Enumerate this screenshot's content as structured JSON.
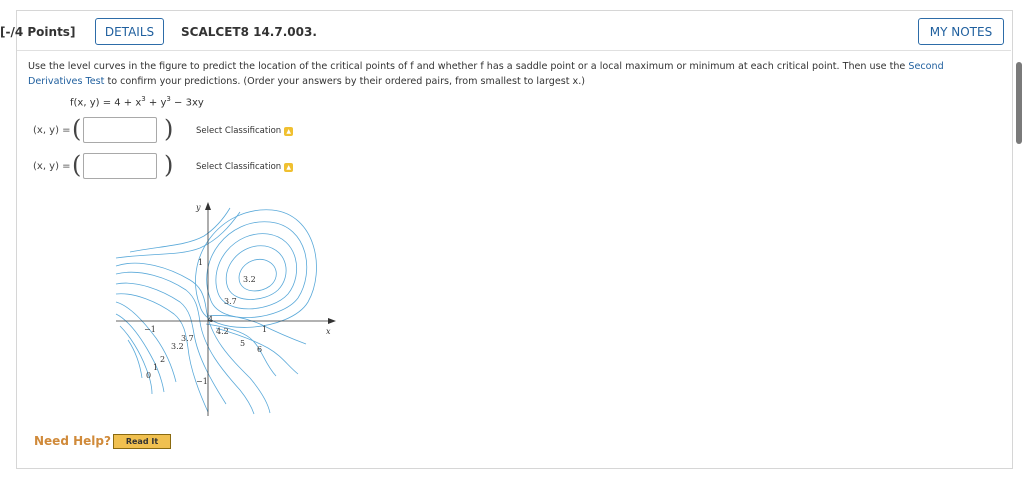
{
  "header": {
    "points": "[-/4 Points]",
    "details_label": "DETAILS",
    "problem_code": "SCALCET8 14.7.003.",
    "my_notes_label": "MY NOTES"
  },
  "question": {
    "text_before_link": "Use the level curves in the figure to predict the location of the critical points of f and whether f has a saddle point or a local maximum or minimum at each critical point. Then use the ",
    "link_text": "Second Derivatives Test",
    "text_after_link": " to confirm your predictions. (Order your answers by their ordered pairs, from smallest to largest x.)",
    "formula_prefix": "f(x, y) = 4 + x",
    "formula_mid": " + y",
    "formula_suffix": " − 3xy",
    "exp": "3"
  },
  "answers": [
    {
      "label": "(x, y) =",
      "open": "(",
      "close": ")",
      "value": "",
      "select": "Select Classification"
    },
    {
      "label": "(x, y) =",
      "open": "(",
      "close": ")",
      "value": "",
      "select": "Select Classification"
    }
  ],
  "graph": {
    "y_axis": "y",
    "x_axis": "x",
    "labels": [
      "1",
      "−1",
      "1",
      "−1",
      "3.2",
      "3.7",
      "4",
      "4.2",
      "5",
      "6",
      "3.7",
      "3.2",
      "2",
      "1",
      "0"
    ]
  },
  "footer": {
    "need_help": "Need Help?",
    "read_it": "Read It"
  },
  "colors": {
    "link": "#1f5f9e",
    "contour": "#5aa9d9",
    "need_help": "#d08a3a",
    "read_button": "#f0c050"
  }
}
